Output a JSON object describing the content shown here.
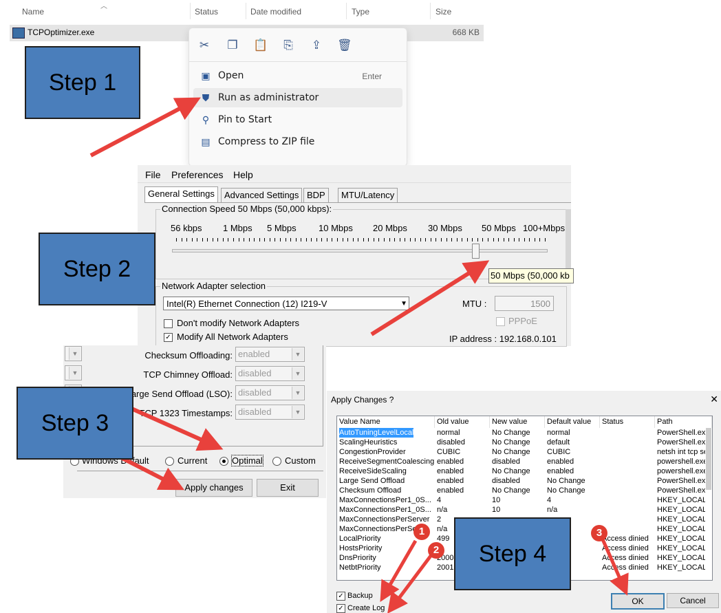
{
  "explorer": {
    "columns": [
      "Name",
      "Status",
      "Date modified",
      "Type",
      "Size"
    ],
    "file": {
      "name": "TCPOptimizer.exe",
      "size": "668 KB"
    },
    "context_menu": {
      "toolbar_icons": [
        "cut-icon",
        "copy-icon",
        "paste-icon",
        "rename-icon",
        "share-icon",
        "delete-icon"
      ],
      "items": [
        {
          "label": "Open",
          "shortcut": "Enter",
          "icon": "open-icon"
        },
        {
          "label": "Run as administrator",
          "icon": "shield-icon"
        },
        {
          "label": "Pin to Start",
          "icon": "pin-icon"
        },
        {
          "label": "Compress to ZIP file",
          "icon": "zip-icon"
        }
      ]
    }
  },
  "optimizer": {
    "menu": [
      "File",
      "Preferences",
      "Help"
    ],
    "tabs": [
      "General Settings",
      "Advanced Settings",
      "BDP",
      "MTU/Latency"
    ],
    "connection_speed_label": "Connection Speed  50 Mbps (50,000 kbps):",
    "speed_marks": [
      "56 kbps",
      "1 Mbps",
      "5 Mbps",
      "10 Mbps",
      "20 Mbps",
      "30 Mbps",
      "50 Mbps",
      "100+Mbps"
    ],
    "slider_value_fraction": 0.81,
    "tooltip": "50 Mbps (50,000 kb",
    "adapter_group_label": "Network Adapter selection",
    "adapter": "Intel(R) Ethernet Connection (12) I219-V",
    "mtu_label": "MTU :",
    "mtu_value": "1500",
    "pppoe_label": "PPPoE",
    "dont_modify_label": "Don't modify Network Adapters",
    "modify_all_label": "Modify All Network Adapters",
    "ip_label": "IP address : 192.168.0.101"
  },
  "settings": {
    "rows": [
      {
        "label": "Checksum Offloading:",
        "value": "enabled"
      },
      {
        "label": "TCP Chimney Offload:",
        "value": "disabled"
      },
      {
        "label": "arge Send Offload (LSO):",
        "value": "disabled"
      },
      {
        "label": "TCP 1323 Timestamps:",
        "value": "disabled"
      }
    ],
    "radios": [
      "Windows Default",
      "Current",
      "Optimal",
      "Custom"
    ],
    "selected_radio": "Optimal",
    "apply_label": "Apply changes",
    "exit_label": "Exit"
  },
  "apply_dialog": {
    "title": "Apply Changes ?",
    "close_glyph": "✕",
    "columns": [
      "Value Name",
      "Old value",
      "New value",
      "Default value",
      "Status",
      "Path"
    ],
    "rows": [
      [
        "AutoTuningLevelLocal",
        "normal",
        "No Change",
        "normal",
        "",
        "PowerShell.exe"
      ],
      [
        "ScalingHeuristics",
        "disabled",
        "No Change",
        "default",
        "",
        "PowerShell.exe"
      ],
      [
        "CongestionProvider",
        "CUBIC",
        "No Change",
        "CUBIC",
        "",
        "netsh int tcp se"
      ],
      [
        "ReceiveSegmentCoalescing",
        "enabled",
        "disabled",
        "enabled",
        "",
        "powershell.exe"
      ],
      [
        "ReceiveSideScaling",
        "enabled",
        "No Change",
        "enabled",
        "",
        "powershell.exe"
      ],
      [
        "Large Send Offload",
        "enabled",
        "disabled",
        "No Change",
        "",
        "PowerShell.exe"
      ],
      [
        "Checksum Offload",
        "enabled",
        "No Change",
        "No Change",
        "",
        "PowerShell.exe"
      ],
      [
        "MaxConnectionsPer1_0S...",
        "4",
        "10",
        "4",
        "",
        "HKEY_LOCAL"
      ],
      [
        "MaxConnectionsPer1_0S...",
        "n/a",
        "10",
        "n/a",
        "",
        "HKEY_LOCAL"
      ],
      [
        "MaxConnectionsPerServer",
        "2",
        "",
        "",
        "",
        "HKEY_LOCAL"
      ],
      [
        "MaxConnectionsPerSe",
        "n/a",
        "",
        "",
        "",
        "HKEY_LOCAL"
      ],
      [
        "LocalPriority",
        "499",
        "",
        "",
        "Access dinied",
        "HKEY_LOCAL"
      ],
      [
        "HostsPriority",
        "",
        "",
        "",
        "Access dinied",
        "HKEY_LOCAL"
      ],
      [
        "DnsPriority",
        "2000",
        "",
        "",
        "Access dinied",
        "HKEY_LOCAL"
      ],
      [
        "NetbtPriority",
        "2001",
        "",
        "",
        "Access dinied",
        "HKEY_LOCAL"
      ]
    ],
    "backup_label": "Backup",
    "create_log_label": "Create Log",
    "ok_label": "OK",
    "cancel_label": "Cancel"
  },
  "steps": [
    "Step 1",
    "Step 2",
    "Step 3",
    "Step 4"
  ],
  "badges": [
    "1",
    "2",
    "3"
  ],
  "colors": {
    "step_fill": "#4a7ebb",
    "arrow": "#e8413c",
    "selection": "#3399ff"
  }
}
